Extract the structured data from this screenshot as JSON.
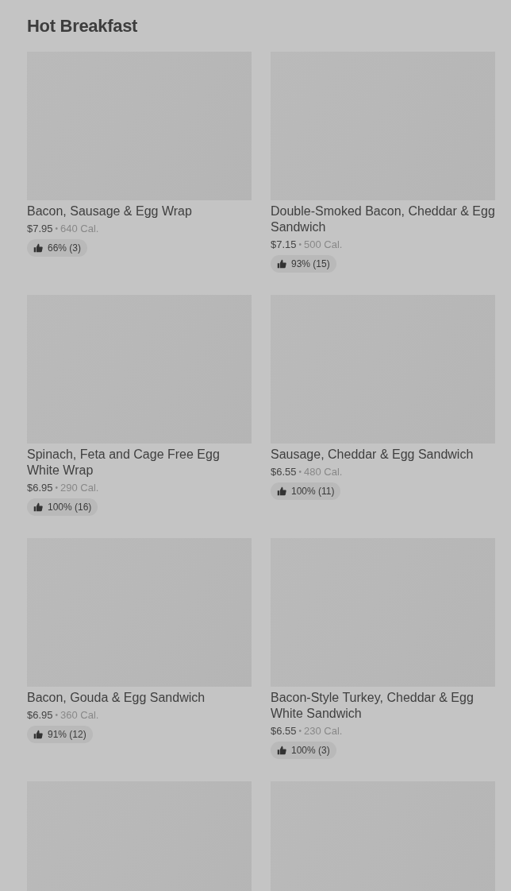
{
  "section": {
    "title": "Hot Breakfast"
  },
  "items": [
    {
      "kind": "full",
      "name": "Bacon, Sausage & Egg Wrap",
      "price": "$7.95",
      "separator": "•",
      "calories": "640 Cal.",
      "rating": "66% (3)"
    },
    {
      "kind": "full",
      "name": "Double-Smoked Bacon, Cheddar & Egg Sandwich",
      "price": "$7.15",
      "separator": "•",
      "calories": "500 Cal.",
      "rating": "93% (15)"
    },
    {
      "kind": "full",
      "name": "Spinach, Feta and Cage Free Egg White Wrap",
      "price": "$6.95",
      "separator": "•",
      "calories": "290 Cal.",
      "rating": "100% (16)"
    },
    {
      "kind": "full",
      "name": "Sausage, Cheddar & Egg Sandwich",
      "price": "$6.55",
      "separator": "•",
      "calories": "480 Cal.",
      "rating": "100% (11)"
    },
    {
      "kind": "full",
      "name": "Bacon, Gouda & Egg Sandwich",
      "price": "$6.95",
      "separator": "•",
      "calories": "360 Cal.",
      "rating": "91% (12)"
    },
    {
      "kind": "full",
      "name": "Bacon-Style Turkey, Cheddar & Egg White Sandwich",
      "price": "$6.55",
      "separator": "•",
      "calories": "230 Cal.",
      "rating": "100% (3)"
    },
    {
      "kind": "image_only"
    },
    {
      "kind": "image_only"
    }
  ]
}
